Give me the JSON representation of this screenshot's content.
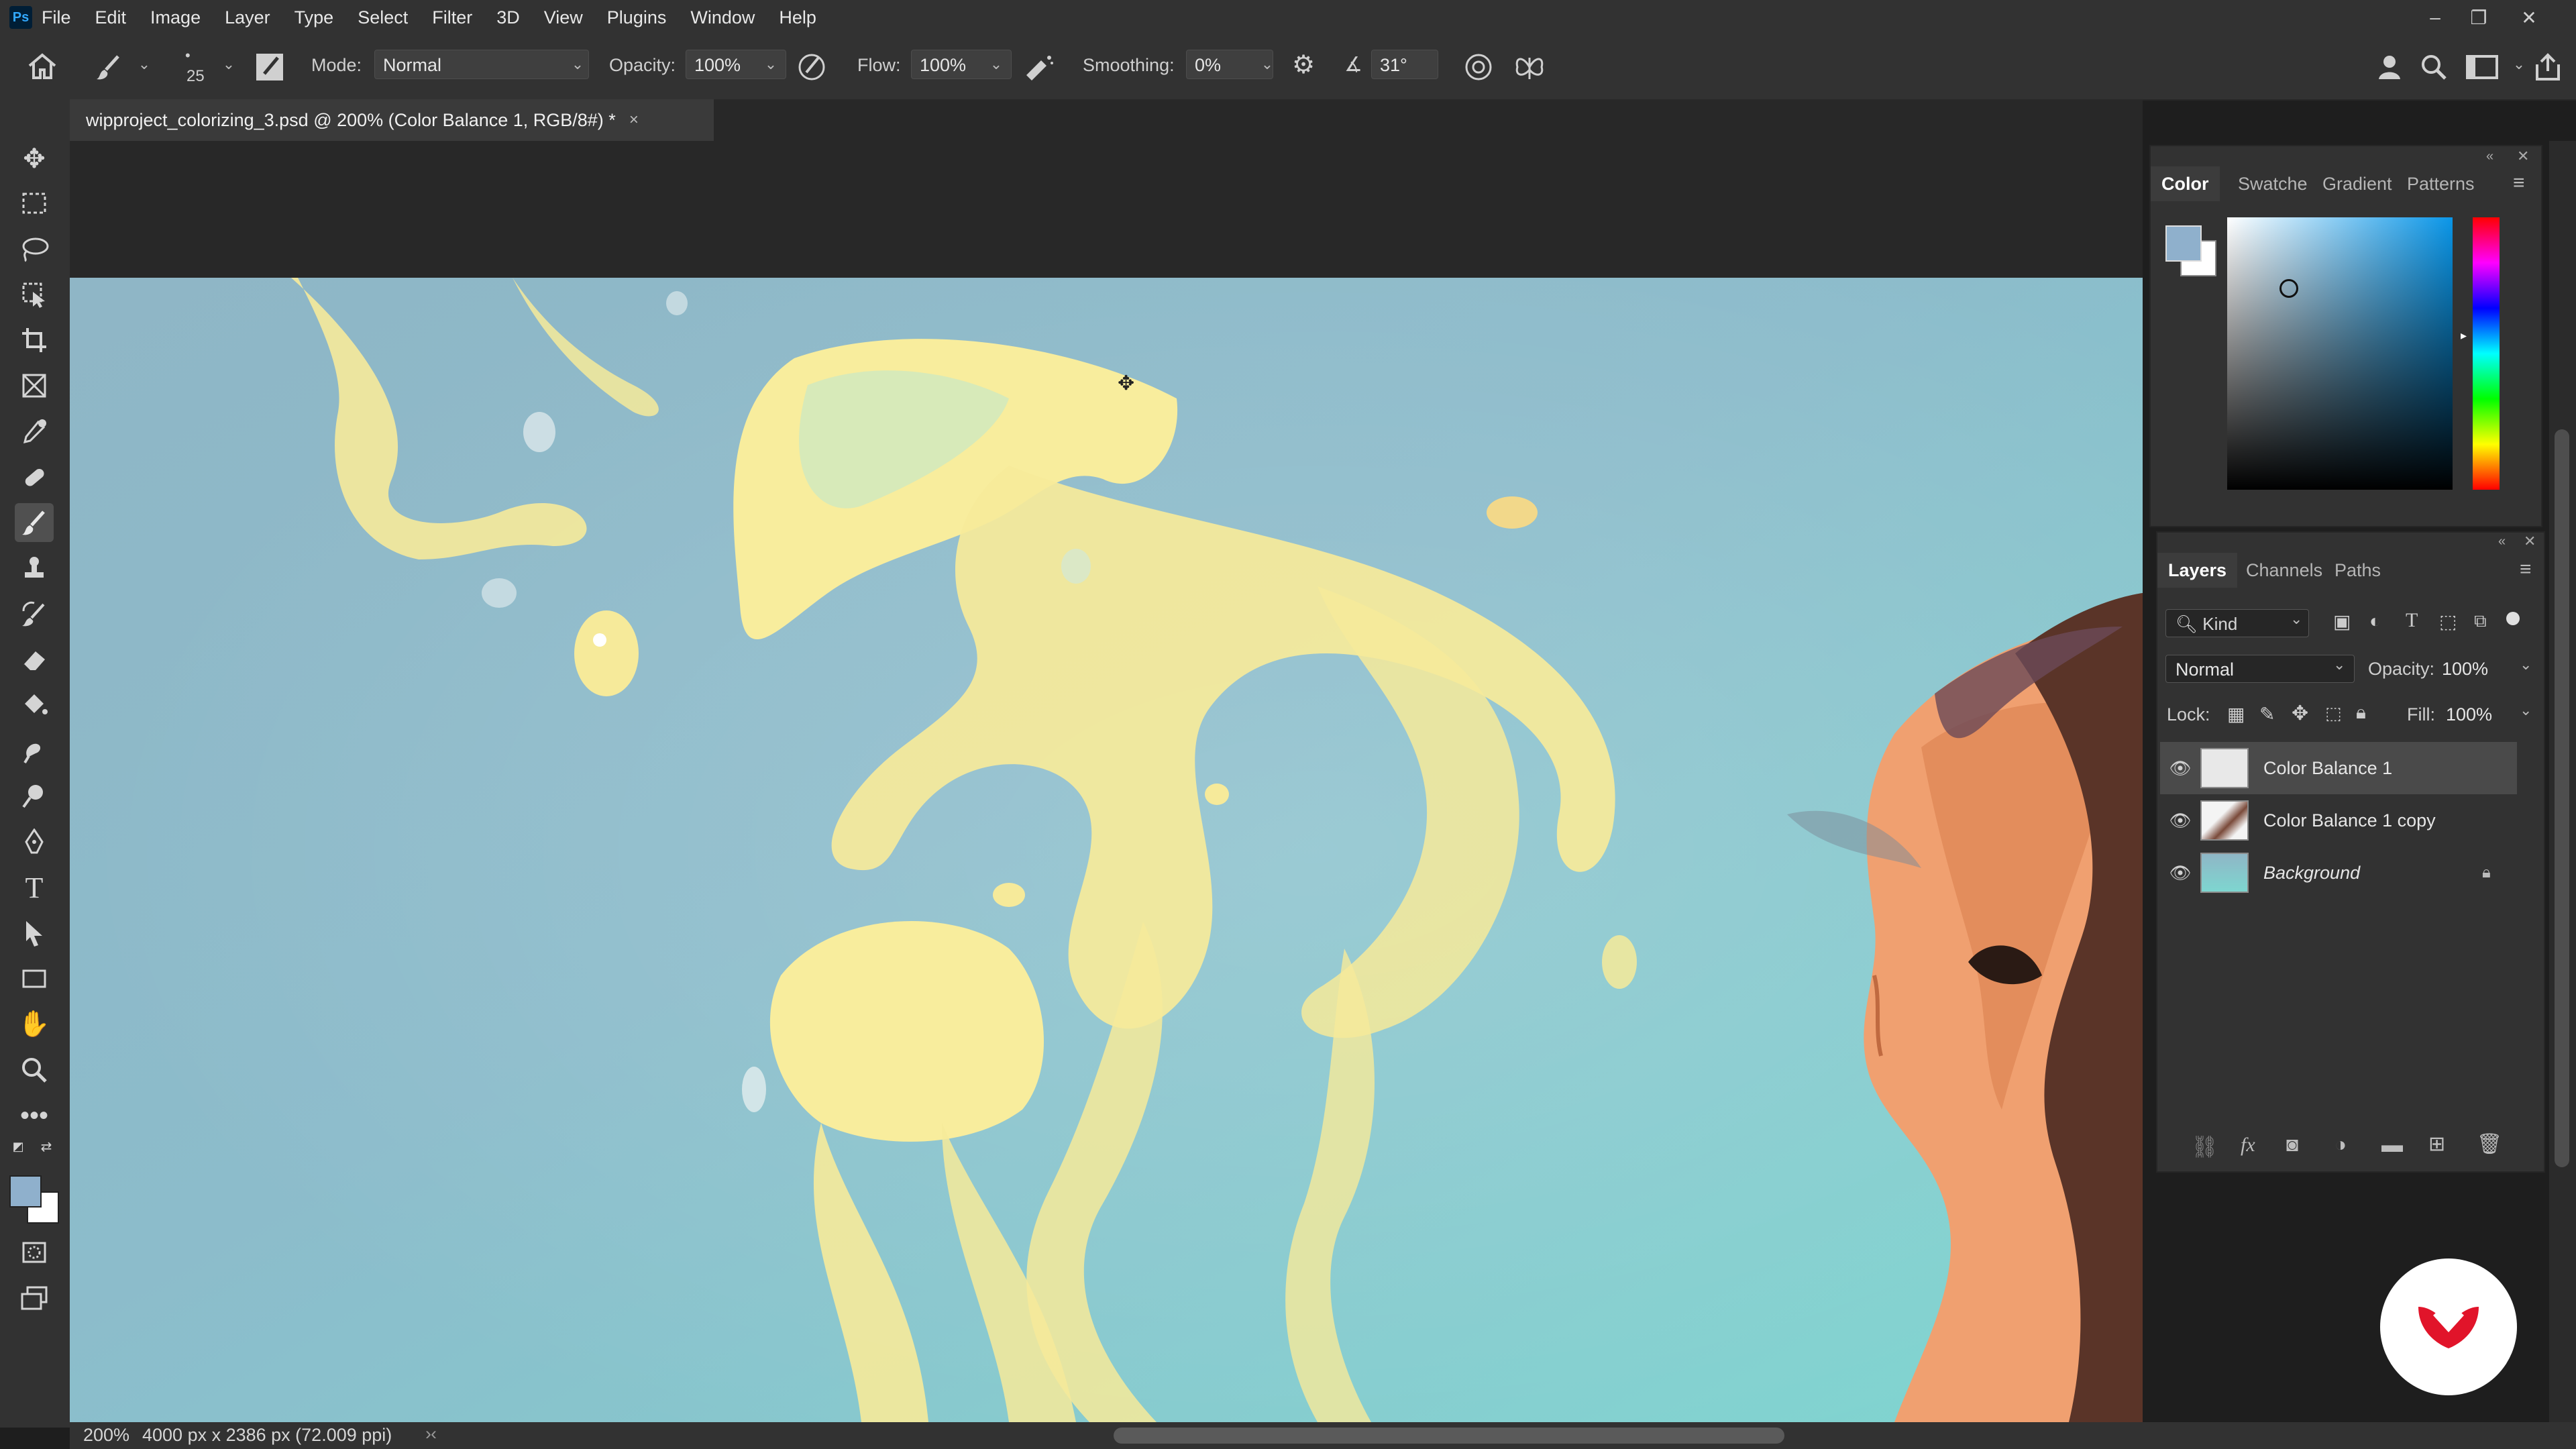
{
  "menubar": {
    "logo": "Ps",
    "items": [
      "File",
      "Edit",
      "Image",
      "Layer",
      "Type",
      "Select",
      "Filter",
      "3D",
      "View",
      "Plugins",
      "Window",
      "Help"
    ]
  },
  "options": {
    "brush_size": "25",
    "mode_label": "Mode:",
    "mode_value": "Normal",
    "opacity_label": "Opacity:",
    "opacity_value": "100%",
    "flow_label": "Flow:",
    "flow_value": "100%",
    "smoothing_label": "Smoothing:",
    "smoothing_value": "0%",
    "angle_value": "31°"
  },
  "document": {
    "tab_title": "wipproject_colorizing_3.psd @ 200% (Color Balance 1, RGB/8#) *",
    "close_glyph": "×"
  },
  "status": {
    "zoom": "200%",
    "dimensions": "4000 px x 2386 px (72.009 ppi)"
  },
  "color_panel": {
    "tabs": [
      "Color",
      "Swatche",
      "Gradient",
      "Patterns"
    ],
    "foreground": "#8fb0cc",
    "background": "#ffffff"
  },
  "layers_panel": {
    "tabs": [
      "Layers",
      "Channels",
      "Paths"
    ],
    "kind_label": "Kind",
    "blend_mode": "Normal",
    "opacity_label": "Opacity:",
    "opacity_value": "100%",
    "lock_label": "Lock:",
    "fill_label": "Fill:",
    "fill_value": "100%",
    "layers": [
      {
        "name": "Color Balance 1",
        "selected": true
      },
      {
        "name": "Color Balance 1 copy",
        "selected": false
      },
      {
        "name": "Background",
        "selected": false,
        "locked": true
      }
    ]
  },
  "icons": {
    "home": "home-icon",
    "brush": "brush-icon",
    "eye": "eye-icon",
    "lock": "lock-icon"
  }
}
